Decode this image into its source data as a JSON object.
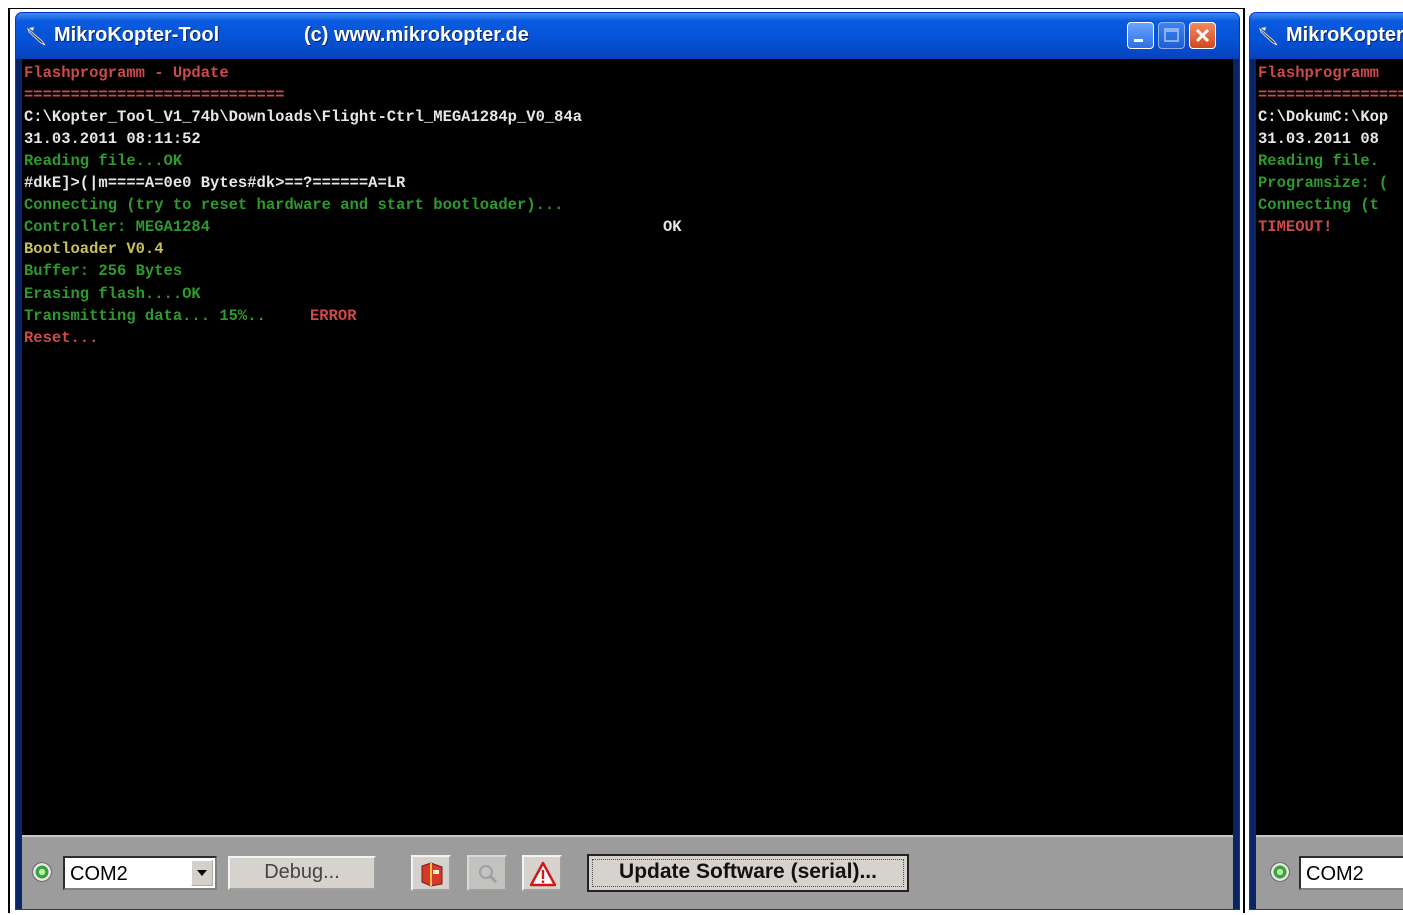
{
  "window_main": {
    "title": "MikroKopter-Tool",
    "subtitle": "(c) www.mikrokopter.de",
    "console_lines": [
      {
        "text": "Flashprogramm - Update",
        "color": "red"
      },
      {
        "text": "============================",
        "color": "red"
      },
      {
        "text": "C:\\Kopter_Tool_V1_74b\\Downloads\\Flight-Ctrl_MEGA1284p_V0_84a",
        "color": "white"
      },
      {
        "text": "31.03.2011 08:11:52",
        "color": "white"
      },
      {
        "text": "Reading file...OK",
        "color": "green"
      },
      {
        "text": "#dkE]>(|m====A=0e0 Bytes#dk>==?======A=LR",
        "color": "white"
      },
      {
        "text": "Connecting (try to reset hardware and start bootloader)...",
        "color": "green"
      },
      {
        "text": "Controller: MEGA1284",
        "color": "green"
      },
      {
        "text": "Bootloader V0.4",
        "color": "green"
      },
      {
        "text": "Buffer: 256 Bytes",
        "color": "green"
      },
      {
        "text": "Erasing flash....OK",
        "color": "green"
      },
      {
        "text": "Transmitting data... 15%..",
        "color": "green"
      },
      {
        "text": "Reset...",
        "color": "red"
      }
    ],
    "ok_right": "OK",
    "error_label": "ERROR",
    "com_port": "COM2",
    "debug_label": "Debug...",
    "update_label": "Update Software (serial)..."
  },
  "window_second": {
    "title": "MikroKopter",
    "console_lines": [
      {
        "text": "Flashprogramm",
        "color": "red"
      },
      {
        "text": "==================",
        "color": "red"
      },
      {
        "text": "C:\\DokumC:\\Kop",
        "color": "white"
      },
      {
        "text": "31.03.2011 08",
        "color": "white"
      },
      {
        "text": "Reading file.",
        "color": "green"
      },
      {
        "text": "Programsize: (",
        "color": "green"
      },
      {
        "text": "Connecting (t",
        "color": "green"
      },
      {
        "text": "TIMEOUT!",
        "color": "red"
      }
    ],
    "com_port": "COM2"
  },
  "icons": [
    "app-icon",
    "minimize-icon",
    "maximize-icon",
    "close-icon",
    "connection-led-icon",
    "dropdown-arrow-icon",
    "red-book-icon",
    "search-icon",
    "warning-icon"
  ],
  "colors": {
    "titlebar": "#0553d6",
    "console_bg": "#000000",
    "text_red": "#cc4a4a",
    "text_green": "#2e9a2e",
    "toolbar_bg": "#9c9c9c"
  }
}
